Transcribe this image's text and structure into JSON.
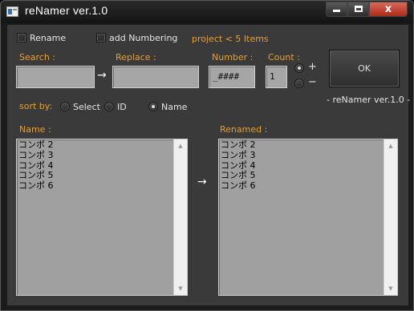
{
  "window": {
    "title": "reNamer ver.1.0",
    "controls": {
      "minimize": "minimize",
      "maximize": "maximize",
      "close": "x"
    }
  },
  "options": {
    "rename_label": "Rename",
    "add_numbering_label": "add Numbering",
    "project_info": "project < 5 Items"
  },
  "fields": {
    "search_label": "Search :",
    "search_value": "",
    "replace_label": "Replace :",
    "replace_value": "",
    "number_label": "Number :",
    "number_value": "_####",
    "count_label": "Count :",
    "count_value": "1",
    "arrow": "→",
    "plus_label": "+",
    "minus_label": "−",
    "selected_direction": "+"
  },
  "ok_button": {
    "label": "OK"
  },
  "version_note": "- reNamer ver.1.0 -",
  "sort": {
    "label": "sort by:",
    "options": [
      "Select",
      "ID",
      "Name"
    ],
    "selected": "Name"
  },
  "lists": {
    "name_label": "Name :",
    "renamed_label": "Renamed :",
    "arrow": "→",
    "name_items": [
      "コンポ 2",
      "コンポ 3",
      "コンポ 4",
      "コンポ 5",
      "コンポ 6"
    ],
    "renamed_items": [
      "コンポ 2",
      "コンポ 3",
      "コンポ 4",
      "コンポ 5",
      "コンポ 6"
    ],
    "scroll_up": "▲",
    "scroll_down": "▼"
  },
  "colors": {
    "accent_label": "#e8a02a",
    "window_bg": "#3a3a3a",
    "field_bg": "#a6a6a6",
    "close_button": "#c0392b"
  }
}
